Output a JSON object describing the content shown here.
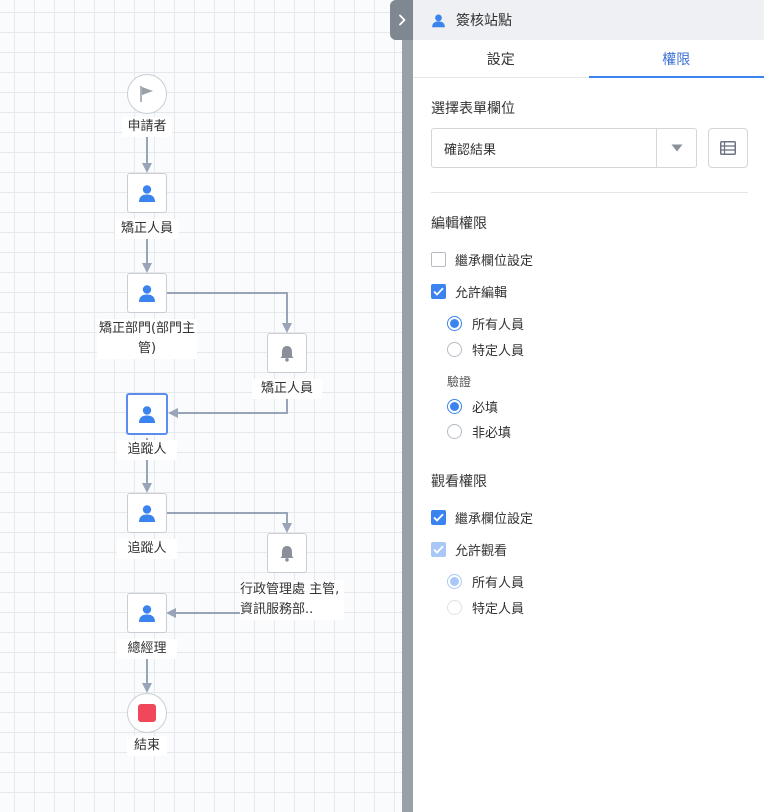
{
  "flow": {
    "nodes": [
      {
        "id": "applicant",
        "label": "申請者"
      },
      {
        "id": "corrector",
        "label": "矯正人員"
      },
      {
        "id": "correct-dept",
        "label": "矯正部門(部門主管)"
      },
      {
        "id": "notify-corrector",
        "label": "矯正人員"
      },
      {
        "id": "tracker-1",
        "label": "追蹤人"
      },
      {
        "id": "tracker-2",
        "label": "追蹤人"
      },
      {
        "id": "notify-admin",
        "label": "行政管理處 主管,資訊服務部.."
      },
      {
        "id": "gm",
        "label": "總經理"
      },
      {
        "id": "end",
        "label": "結束"
      }
    ]
  },
  "panel": {
    "title": "簽核站點",
    "tabs": [
      {
        "label": "設定",
        "active": false
      },
      {
        "label": "權限",
        "active": true
      }
    ],
    "field_section_title": "選擇表單欄位",
    "field_select_value": "確認結果",
    "edit_section": {
      "title": "編輯權限",
      "inherit_label": "繼承欄位設定",
      "inherit_checked": false,
      "allow_label": "允許編輯",
      "allow_checked": true,
      "who_options": [
        {
          "label": "所有人員",
          "selected": true
        },
        {
          "label": "特定人員",
          "selected": false
        }
      ],
      "validation_title": "驗證",
      "validation_options": [
        {
          "label": "必填",
          "selected": true
        },
        {
          "label": "非必填",
          "selected": false
        }
      ]
    },
    "view_section": {
      "title": "觀看權限",
      "inherit_label": "繼承欄位設定",
      "inherit_checked": true,
      "allow_label": "允許觀看",
      "allow_checked": true,
      "allow_disabled": true,
      "who_options": [
        {
          "label": "所有人員",
          "selected": true,
          "disabled": true
        },
        {
          "label": "特定人員",
          "selected": false,
          "disabled": true
        }
      ]
    }
  },
  "colors": {
    "accent": "#3b84f0",
    "edge": "#9aa4b8",
    "selected_border": "#5b8def",
    "end_stop": "#f0475a"
  }
}
